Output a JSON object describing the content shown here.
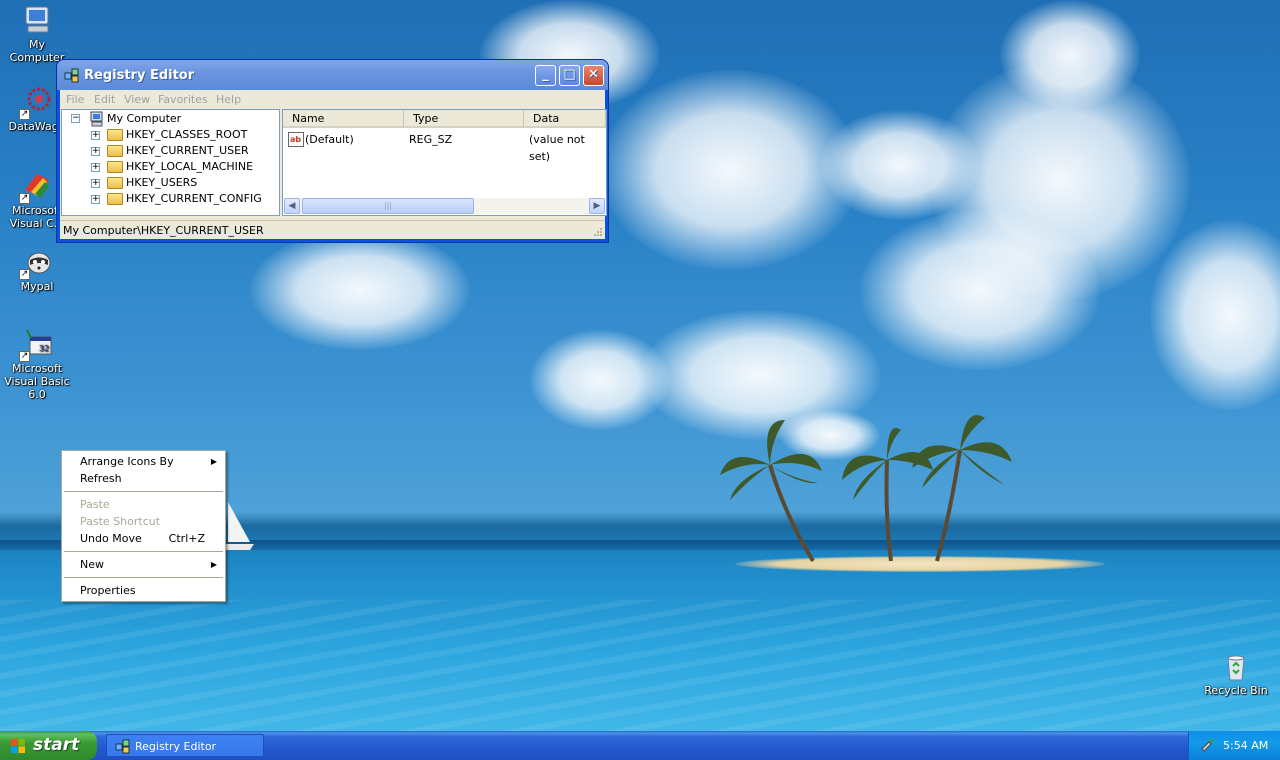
{
  "desktop": {
    "icons": [
      {
        "label": "My Computer",
        "icon": "my-computer-icon"
      },
      {
        "label": "DataWago",
        "icon": "datawago-icon"
      },
      {
        "label": "Microsoft Visual C...",
        "icon": "visual-cpp-icon"
      },
      {
        "label": "Mypal",
        "icon": "mypal-icon"
      },
      {
        "label": "Microsoft Visual Basic 6.0",
        "icon": "visual-basic-icon"
      },
      {
        "label": "Recycle Bin",
        "icon": "recycle-bin-icon"
      }
    ]
  },
  "window": {
    "title": "Registry Editor",
    "menu": [
      "File",
      "Edit",
      "View",
      "Favorites",
      "Help"
    ],
    "tree": {
      "root": "My Computer",
      "keys": [
        "HKEY_CLASSES_ROOT",
        "HKEY_CURRENT_USER",
        "HKEY_LOCAL_MACHINE",
        "HKEY_USERS",
        "HKEY_CURRENT_CONFIG"
      ]
    },
    "list": {
      "columns": [
        "Name",
        "Type",
        "Data"
      ],
      "rows": [
        {
          "name": "(Default)",
          "type": "REG_SZ",
          "data": "(value not set)"
        }
      ]
    },
    "status": "My Computer\\HKEY_CURRENT_USER"
  },
  "context_menu": {
    "items": [
      {
        "label": "Arrange Icons By",
        "submenu": true,
        "disabled": false
      },
      {
        "label": "Refresh",
        "disabled": false
      },
      {
        "label": "Paste",
        "disabled": true
      },
      {
        "label": "Paste Shortcut",
        "disabled": true
      },
      {
        "label": "Undo Move",
        "accel": "Ctrl+Z",
        "disabled": false
      },
      {
        "label": "New",
        "submenu": true,
        "disabled": false
      },
      {
        "label": "Properties",
        "disabled": false
      }
    ]
  },
  "taskbar": {
    "start_label": "start",
    "tasks": [
      {
        "label": "Registry Editor"
      }
    ],
    "clock": "5:54 AM"
  },
  "colors": {
    "title_blue": "#0a53e0",
    "taskbar_blue": "#2458cf",
    "start_green": "#3a9a36",
    "disabled_gray": "#aca899"
  }
}
